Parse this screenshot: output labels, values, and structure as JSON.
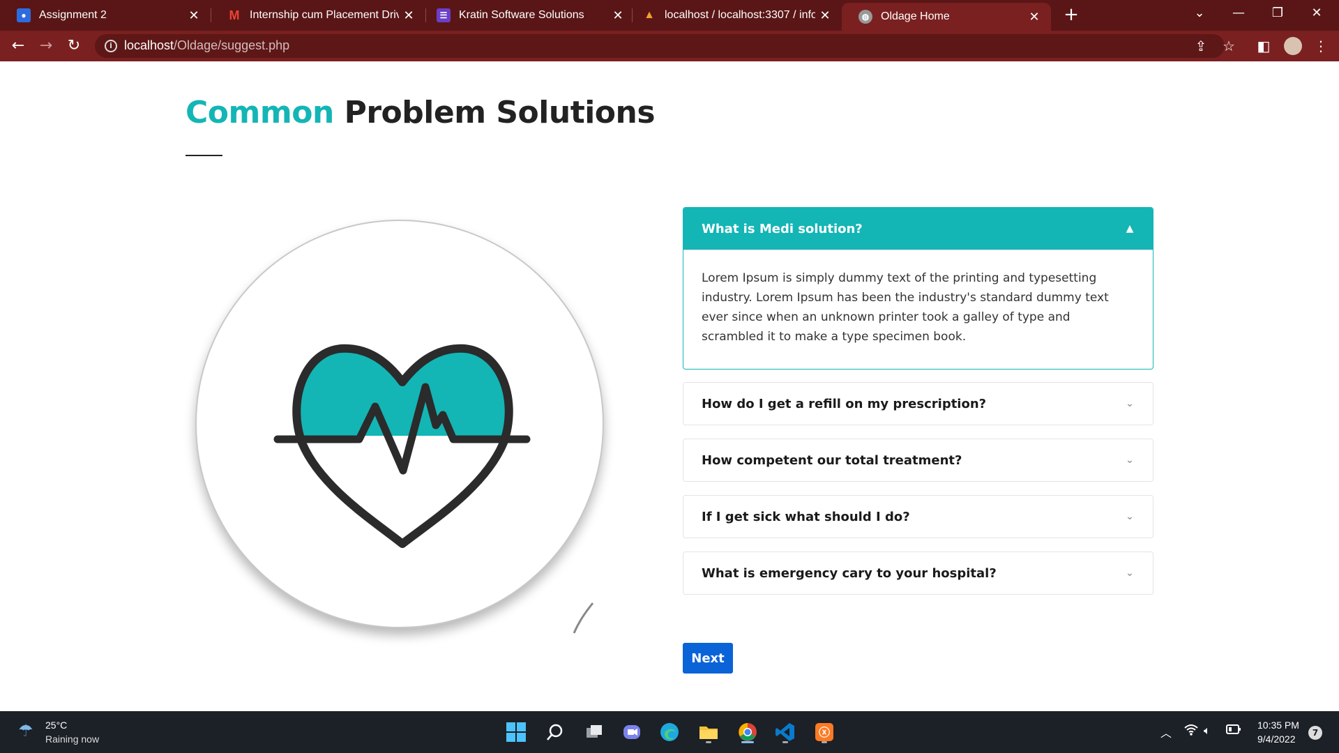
{
  "browser": {
    "tabs": [
      {
        "title": "Assignment 2",
        "icon": "classroom-icon",
        "color": "#2d6cdf"
      },
      {
        "title": "Internship cum Placement Drive-",
        "icon": "gmail-icon",
        "color": "#ea4335"
      },
      {
        "title": "Kratin Software Solutions",
        "icon": "forms-icon",
        "color": "#6a3fc8"
      },
      {
        "title": "localhost / localhost:3307 / info /",
        "icon": "phpmyadmin-icon",
        "color": "#f0a030"
      },
      {
        "title": "Oldage Home",
        "icon": "globe-icon",
        "color": "#cccccc"
      }
    ],
    "url_host": "localhost",
    "url_path": "/Oldage/suggest.php"
  },
  "page": {
    "title_accent": "Common",
    "title_rest": "Problem Solutions",
    "accent_color": "#14b5b5",
    "faq": [
      {
        "question": "What is Medi solution?",
        "expanded": true,
        "answer": "Lorem Ipsum is simply dummy text of the printing and typesetting industry. Lorem Ipsum has been the industry's standard dummy text ever since when an unknown printer took a galley of type and scrambled it to make a type specimen book."
      },
      {
        "question": "How do I get a refill on my prescription?",
        "expanded": false
      },
      {
        "question": "How competent our total treatment?",
        "expanded": false
      },
      {
        "question": "If I get sick what should I do?",
        "expanded": false
      },
      {
        "question": "What is emergency cary to your hospital?",
        "expanded": false
      }
    ],
    "next_label": "Next",
    "next_color": "#0b63d8"
  },
  "taskbar": {
    "weather_temp": "25°C",
    "weather_desc": "Raining now",
    "time": "10:35 PM",
    "date": "9/4/2022",
    "notifications": "7"
  }
}
